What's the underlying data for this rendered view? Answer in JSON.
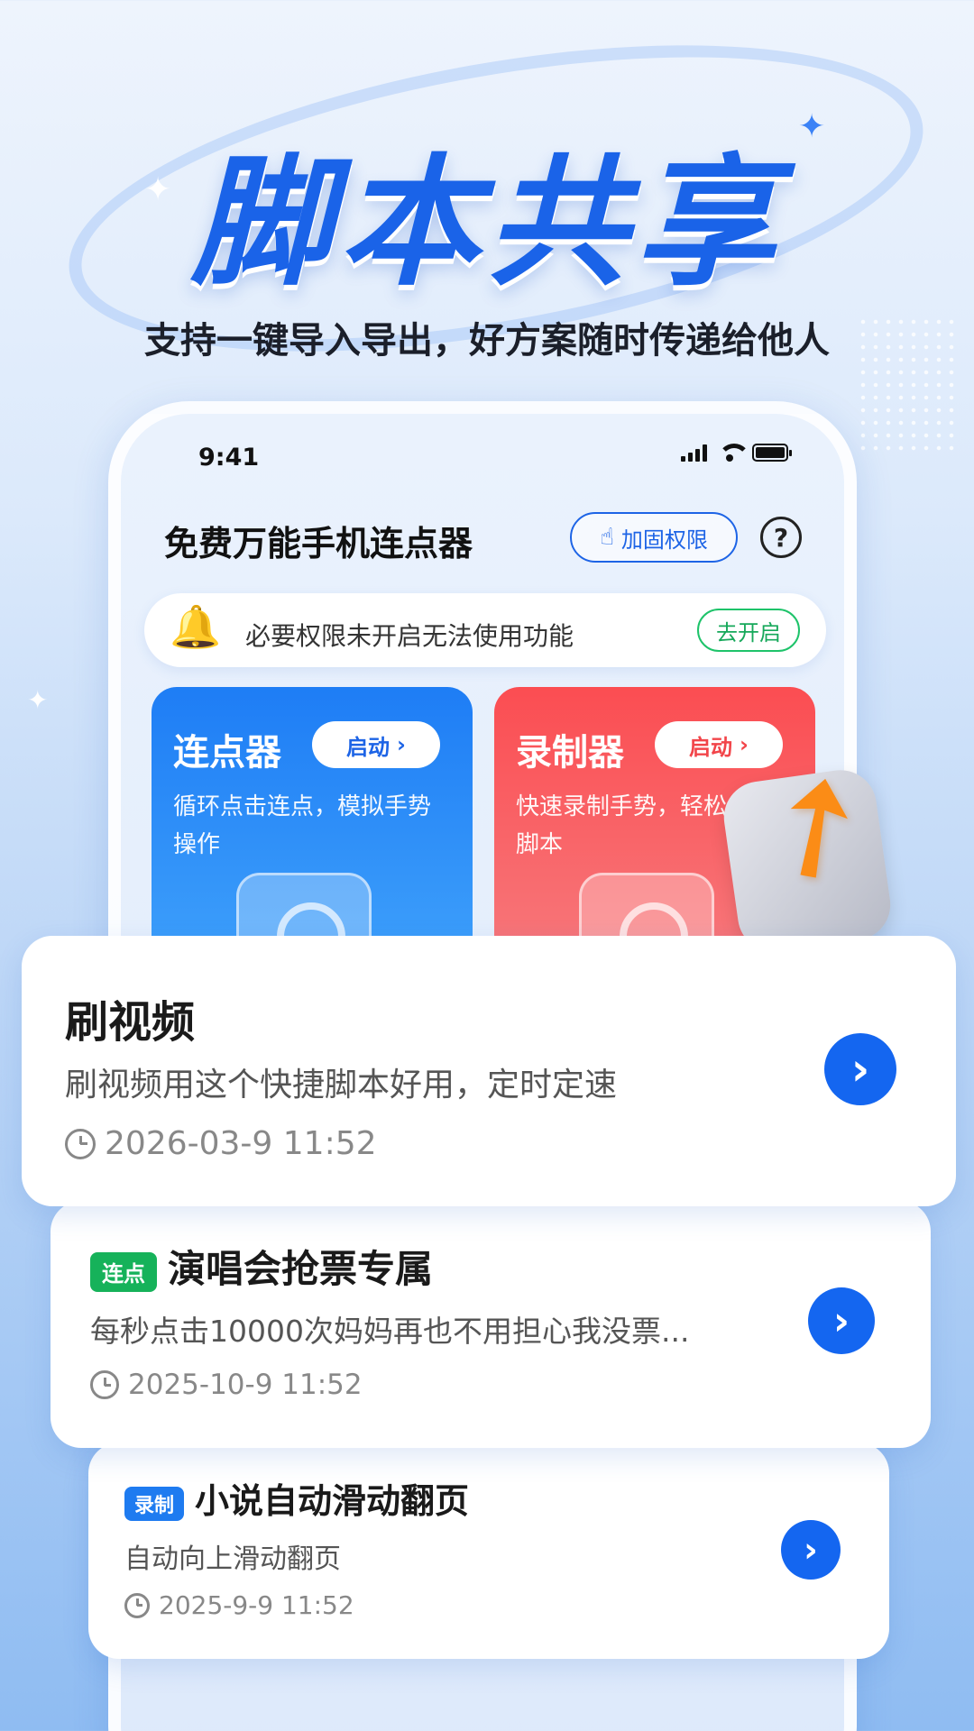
{
  "hero": {
    "title": "脚本共享",
    "subtitle": "支持一键导入导出，好方案随时传递给他人"
  },
  "status_bar": {
    "time": "9:41"
  },
  "app": {
    "title": "免费万能手机连点器",
    "permission_button": "加固权限",
    "help": "?"
  },
  "banner": {
    "text": "必要权限未开启无法使用功能",
    "button": "去开启"
  },
  "features": [
    {
      "title": "连点器",
      "button": "启动",
      "description": "循环点击连点，模拟手势操作"
    },
    {
      "title": "录制器",
      "button": "启动",
      "description": "快速录制手势，轻松创建脚本"
    }
  ],
  "scripts": [
    {
      "tag": "",
      "title": "刷视频",
      "description": "刷视频用这个快捷脚本好用，定时定速",
      "date": "2026-03-9 11:52"
    },
    {
      "tag": "连点",
      "title": "演唱会抢票专属",
      "description": "每秒点击10000次妈妈再也不用担心我没票...",
      "date": "2025-10-9 11:52"
    },
    {
      "tag": "录制",
      "title": "小说自动滑动翻页",
      "description": "自动向上滑动翻页",
      "date": "2025-9-9 11:52"
    }
  ],
  "colors": {
    "primary_blue": "#1466f0",
    "recorder_red": "#fb4d52",
    "tag_green": "#16b25a",
    "banner_green": "#1ec36a"
  },
  "icons": {
    "bell": "bell-icon",
    "hand": "hand-pointer-icon",
    "clock": "clock-icon",
    "arrow": "chevron-right-icon",
    "share": "share-arrow-icon"
  }
}
